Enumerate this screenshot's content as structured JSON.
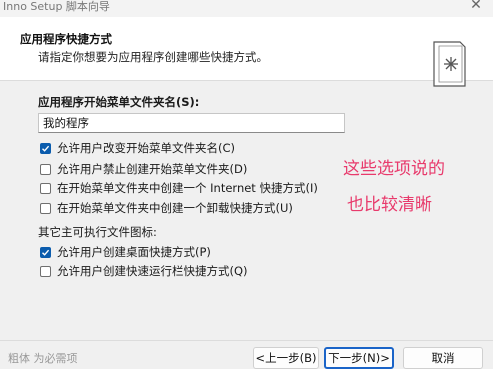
{
  "window": {
    "title": "Inno Setup 脚本向导",
    "close_glyph": "✕"
  },
  "header": {
    "title": "应用程序快捷方式",
    "subtitle": "请指定你想要为应用程序创建哪些快捷方式。",
    "icon": "wizard-star-page-icon"
  },
  "folder": {
    "label": "应用程序开始菜单文件夹名(S):",
    "value": "我的程序"
  },
  "menu_options": [
    {
      "label": "允许用户改变开始菜单文件夹名(C)",
      "checked": true
    },
    {
      "label": "允许用户禁止创建开始菜单文件夹(D)",
      "checked": false
    },
    {
      "label": "在开始菜单文件夹中创建一个 Internet 快捷方式(I)",
      "checked": false
    },
    {
      "label": "在开始菜单文件夹中创建一个卸载快捷方式(U)",
      "checked": false
    }
  ],
  "other_section": {
    "label": "其它主可执行文件图标:"
  },
  "other_options": [
    {
      "label": "允许用户创建桌面快捷方式(P)",
      "checked": true
    },
    {
      "label": "允许用户创建快速运行栏快捷方式(Q)",
      "checked": false
    }
  ],
  "annotation": {
    "line1": "这些选项说的",
    "line2": "也比较清晰"
  },
  "footer": {
    "brand": "粗体 为必需项",
    "back": "<上一步(B)",
    "next": "下一步(N)>",
    "cancel": "取消"
  },
  "colors": {
    "accent": "#0b5cad",
    "annotation": "#e83a6c",
    "default_button_border": "#1a64c8"
  }
}
